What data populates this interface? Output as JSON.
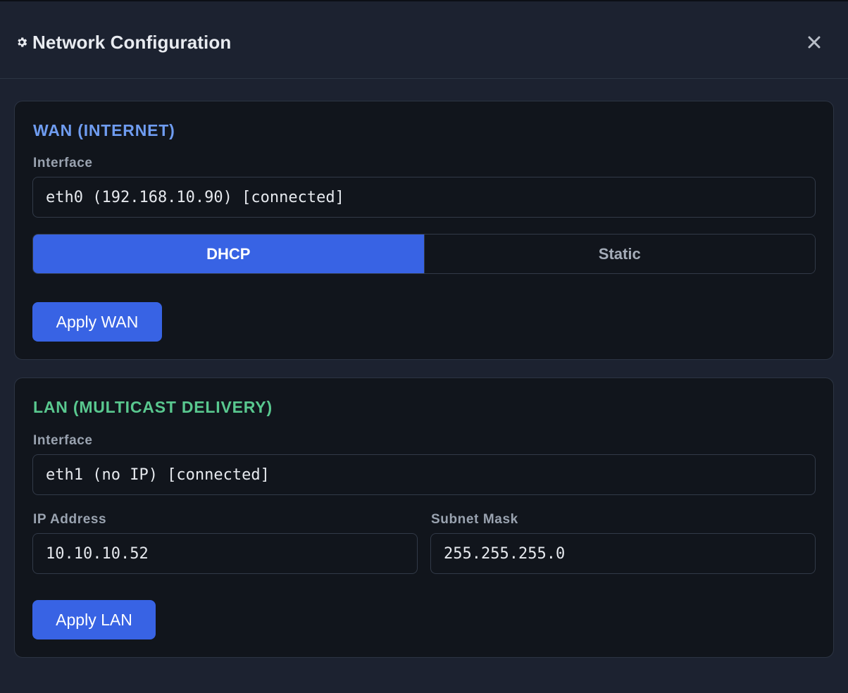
{
  "header": {
    "title": "Network Configuration",
    "title_icon": "gear-icon",
    "close_icon": "close-icon"
  },
  "wan": {
    "title": "WAN (INTERNET)",
    "interface_label": "Interface",
    "interface_value": "eth0 (192.168.10.90) [connected]",
    "modes": [
      {
        "label": "DHCP",
        "selected": true
      },
      {
        "label": "Static",
        "selected": false
      }
    ],
    "apply_label": "Apply WAN"
  },
  "lan": {
    "title": "LAN (MULTICAST DELIVERY)",
    "interface_label": "Interface",
    "interface_value": "eth1 (no IP) [connected]",
    "ip_label": "IP Address",
    "ip_value": "10.10.10.52",
    "mask_label": "Subnet Mask",
    "mask_value": "255.255.255.0",
    "apply_label": "Apply LAN"
  },
  "colors": {
    "accent": "#3863e4",
    "wan_title": "#6f9cf0",
    "lan_title": "#59c88f",
    "background": "#1c2230",
    "panel": "#11151c"
  }
}
